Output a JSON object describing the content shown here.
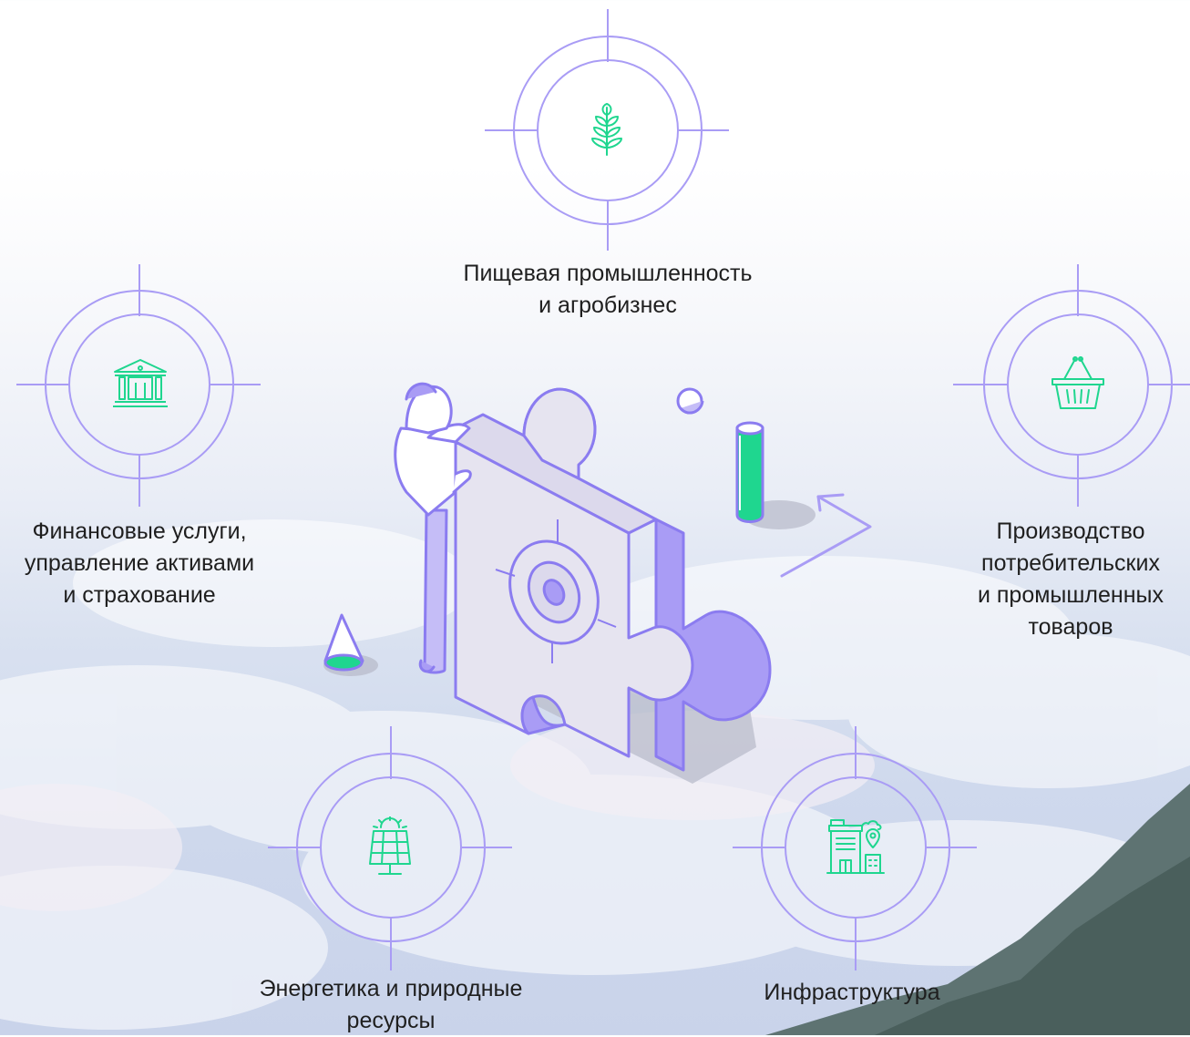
{
  "colors": {
    "accent_purple": "#a99cf5",
    "accent_green": "#1fd68f",
    "text": "#1f1f1f",
    "puzzle_face": "#e6e4f0",
    "puzzle_side": "#a99cf5"
  },
  "sectors": [
    {
      "id": "food",
      "icon": "wheat-icon",
      "label": "Пищевая промышленность\nи агробизнес"
    },
    {
      "id": "finance",
      "icon": "bank-building-icon",
      "label": "Финансовые услуги,\nуправление активами\nи страхование"
    },
    {
      "id": "consumer",
      "icon": "shopping-basket-icon",
      "label": "Производство\nпотребительских\nи промышленных\nтоваров"
    },
    {
      "id": "energy",
      "icon": "solar-panel-icon",
      "label": "Энергетика и природные\nресурсы"
    },
    {
      "id": "infra",
      "icon": "city-infrastructure-icon",
      "label": "Инфраструктура"
    }
  ]
}
